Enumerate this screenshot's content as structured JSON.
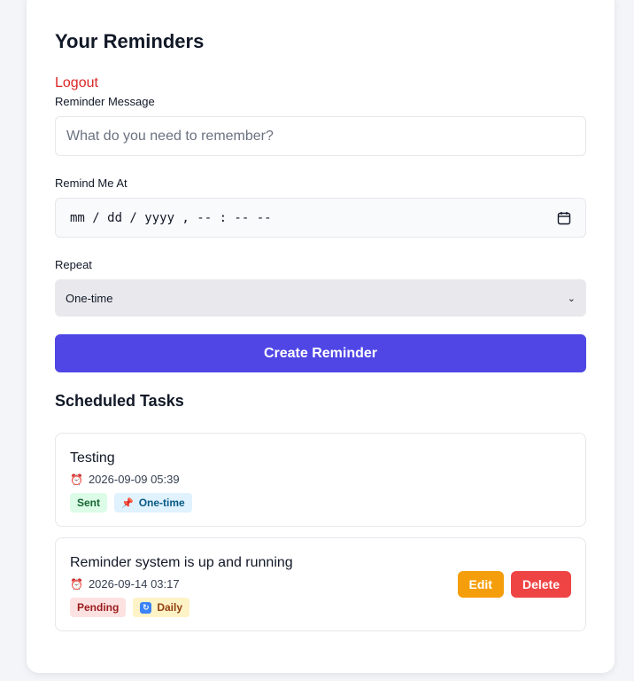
{
  "header": {
    "title": "Your Reminders",
    "logout_label": "Logout"
  },
  "form": {
    "message_label": "Reminder Message",
    "message_placeholder": "What do you need to remember?",
    "remind_label": "Remind Me At",
    "datetime_display": "mm / dd / yyyy ,  -- : --  --",
    "repeat_label": "Repeat",
    "repeat_selected": "One-time",
    "create_label": "Create Reminder"
  },
  "tasks_section": {
    "title": "Scheduled Tasks",
    "tasks": [
      {
        "message": "Testing",
        "time": "2026-09-09 05:39",
        "status": "Sent",
        "repeat": "One-time",
        "status_color": "#dcfce7",
        "repeat_icon": "pin-icon"
      },
      {
        "message": "Reminder system is up and running",
        "time": "2026-09-14 03:17",
        "status": "Pending",
        "repeat": "Daily",
        "status_color": "#fee2e2",
        "repeat_icon": "repeat-icon",
        "edit_label": "Edit",
        "delete_label": "Delete"
      }
    ]
  },
  "colors": {
    "primary": "#4f46e5",
    "danger": "#ef4444",
    "warning": "#f59e0b",
    "logout": "#dc2626"
  }
}
